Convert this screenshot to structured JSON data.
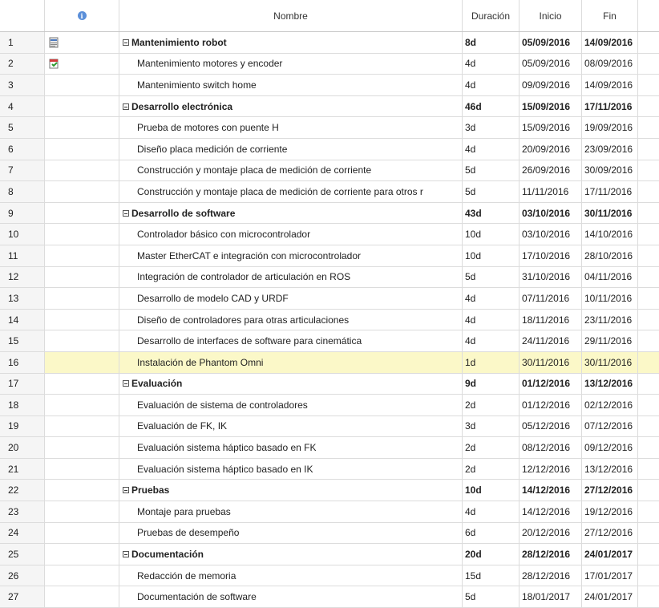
{
  "header": {
    "name": "Nombre",
    "duration": "Duración",
    "start": "Inicio",
    "end": "Fin"
  },
  "rows": [
    {
      "num": "1",
      "name": "Mantenimiento robot",
      "dur": "8d",
      "start": "05/09/2016",
      "end": "14/09/2016",
      "summary": true,
      "icon": "notes-icon"
    },
    {
      "num": "2",
      "name": "Mantenimiento motores y encoder",
      "dur": "4d",
      "start": "05/09/2016",
      "end": "08/09/2016",
      "icon": "calendar-icon"
    },
    {
      "num": "3",
      "name": "Mantenimiento switch home",
      "dur": "4d",
      "start": "09/09/2016",
      "end": "14/09/2016"
    },
    {
      "num": "4",
      "name": "Desarrollo electrónica",
      "dur": "46d",
      "start": "15/09/2016",
      "end": "17/11/2016",
      "summary": true
    },
    {
      "num": "5",
      "name": "Prueba de motores con puente H",
      "dur": "3d",
      "start": "15/09/2016",
      "end": "19/09/2016"
    },
    {
      "num": "6",
      "name": "Diseño placa medición de corriente",
      "dur": "4d",
      "start": "20/09/2016",
      "end": "23/09/2016"
    },
    {
      "num": "7",
      "name": "Construcción y montaje placa de medición de corriente",
      "dur": "5d",
      "start": "26/09/2016",
      "end": "30/09/2016"
    },
    {
      "num": "8",
      "name": "Construcción y montaje placa de medición de corriente para otros r",
      "dur": "5d",
      "start": "11/11/2016",
      "end": "17/11/2016"
    },
    {
      "num": "9",
      "name": "Desarrollo de software",
      "dur": "43d",
      "start": "03/10/2016",
      "end": "30/11/2016",
      "summary": true
    },
    {
      "num": "10",
      "name": "Controlador básico con microcontrolador",
      "dur": "10d",
      "start": "03/10/2016",
      "end": "14/10/2016"
    },
    {
      "num": "11",
      "name": "Master EtherCAT e integración con microcontrolador",
      "dur": "10d",
      "start": "17/10/2016",
      "end": "28/10/2016"
    },
    {
      "num": "12",
      "name": "Integración de controlador de articulación en ROS",
      "dur": "5d",
      "start": "31/10/2016",
      "end": "04/11/2016"
    },
    {
      "num": "13",
      "name": "Desarrollo de modelo CAD y URDF",
      "dur": "4d",
      "start": "07/11/2016",
      "end": "10/11/2016"
    },
    {
      "num": "14",
      "name": "Diseño de controladores para otras articulaciones",
      "dur": "4d",
      "start": "18/11/2016",
      "end": "23/11/2016"
    },
    {
      "num": "15",
      "name": "Desarrollo de interfaces de software para cinemática",
      "dur": "4d",
      "start": "24/11/2016",
      "end": "29/11/2016"
    },
    {
      "num": "16",
      "name": "Instalación de Phantom Omni",
      "dur": "1d",
      "start": "30/11/2016",
      "end": "30/11/2016",
      "highlight": true
    },
    {
      "num": "17",
      "name": "Evaluación",
      "dur": "9d",
      "start": "01/12/2016",
      "end": "13/12/2016",
      "summary": true
    },
    {
      "num": "18",
      "name": "Evaluación de sistema de controladores",
      "dur": "2d",
      "start": "01/12/2016",
      "end": "02/12/2016"
    },
    {
      "num": "19",
      "name": "Evaluación de FK, IK",
      "dur": "3d",
      "start": "05/12/2016",
      "end": "07/12/2016"
    },
    {
      "num": "20",
      "name": "Evaluación sistema háptico basado en FK",
      "dur": "2d",
      "start": "08/12/2016",
      "end": "09/12/2016"
    },
    {
      "num": "21",
      "name": "Evaluación sistema háptico basado en IK",
      "dur": "2d",
      "start": "12/12/2016",
      "end": "13/12/2016"
    },
    {
      "num": "22",
      "name": "Pruebas",
      "dur": "10d",
      "start": "14/12/2016",
      "end": "27/12/2016",
      "summary": true
    },
    {
      "num": "23",
      "name": "Montaje para pruebas",
      "dur": "4d",
      "start": "14/12/2016",
      "end": "19/12/2016"
    },
    {
      "num": "24",
      "name": "Pruebas de desempeño",
      "dur": "6d",
      "start": "20/12/2016",
      "end": "27/12/2016"
    },
    {
      "num": "25",
      "name": "Documentación",
      "dur": "20d",
      "start": "28/12/2016",
      "end": "24/01/2017",
      "summary": true
    },
    {
      "num": "26",
      "name": "Redacción de memoria",
      "dur": "15d",
      "start": "28/12/2016",
      "end": "17/01/2017"
    },
    {
      "num": "27",
      "name": "Documentación de software",
      "dur": "5d",
      "start": "18/01/2017",
      "end": "24/01/2017"
    }
  ]
}
